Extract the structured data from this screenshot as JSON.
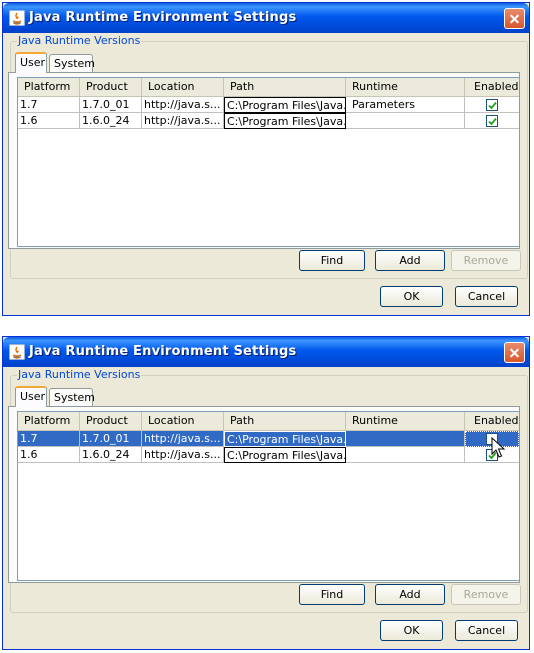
{
  "dialogs": [
    {
      "title": "Java Runtime Environment Settings",
      "group_label": "Java Runtime Versions",
      "tabs": [
        "User",
        "System"
      ],
      "columns": [
        "Platform",
        "Product",
        "Location",
        "Path",
        "Runtime Parameters",
        "Enabled"
      ],
      "rows": [
        {
          "platform": "1.7",
          "product": "1.7.0_01",
          "location": "http://java.s...",
          "path": "C:\\Program Files\\Java...",
          "params": "",
          "enabled": true
        },
        {
          "platform": "1.6",
          "product": "1.6.0_24",
          "location": "http://java.s...",
          "path": "C:\\Program Files\\Java...",
          "params": "",
          "enabled": true
        }
      ],
      "buttons": {
        "find": "Find",
        "add": "Add",
        "remove": "Remove",
        "ok": "OK",
        "cancel": "Cancel"
      }
    },
    {
      "title": "Java Runtime Environment Settings",
      "group_label": "Java Runtime Versions",
      "tabs": [
        "User",
        "System"
      ],
      "columns": [
        "Platform",
        "Product",
        "Location",
        "Path",
        "Runtime Parameters",
        "Enabled"
      ],
      "rows": [
        {
          "platform": "1.7",
          "product": "1.7.0_01",
          "location": "http://java.s...",
          "path": "C:\\Program Files\\Java...",
          "params": "",
          "enabled": false,
          "selected": true
        },
        {
          "platform": "1.6",
          "product": "1.6.0_24",
          "location": "http://java.s...",
          "path": "C:\\Program Files\\Java...",
          "params": "",
          "enabled": true
        }
      ],
      "buttons": {
        "find": "Find",
        "add": "Add",
        "remove": "Remove",
        "ok": "OK",
        "cancel": "Cancel"
      }
    }
  ],
  "colors": {
    "title_bar": "#0058ee",
    "selection": "#316ac5",
    "legend_text": "#0046d5",
    "active_tab": "#f4a732",
    "check": "#21a121"
  }
}
